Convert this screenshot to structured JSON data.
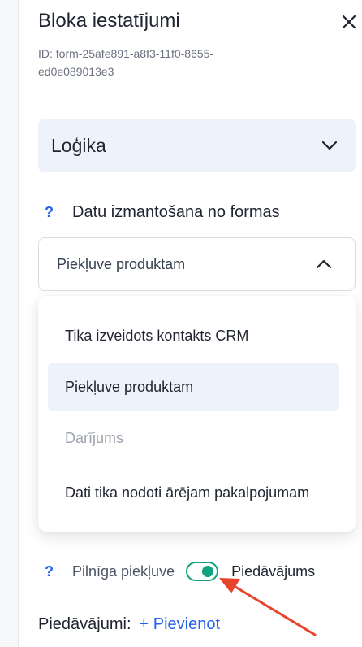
{
  "panel": {
    "title": "Bloka iestatījumi",
    "id_text": "ID: form-25afe891-a8f3-11f0-8655-ed0e089013e3"
  },
  "logic_section": {
    "label": "Loģika"
  },
  "data_usage": {
    "help": "?",
    "label": "Datu izmantošana no formas"
  },
  "select": {
    "value": "Piekļuve produktam",
    "options": [
      {
        "label": "Tika izveidots kontakts CRM",
        "state": "normal"
      },
      {
        "label": "Piekļuve produktam",
        "state": "selected"
      },
      {
        "label": "Darījums",
        "state": "disabled"
      },
      {
        "label": "Dati tika nodoti ārējam pakalpojumam",
        "state": "normal"
      }
    ]
  },
  "access_toggle": {
    "help": "?",
    "left_label": "Pilnīga piekļuve",
    "right_label": "Piedāvājums",
    "on": true
  },
  "offers": {
    "label": "Piedāvājumi:",
    "add_label": "+ Pievienot"
  },
  "colors": {
    "accent": "#2563eb",
    "toggle": "#10a37f",
    "annotation_arrow": "#e8432c",
    "highlight": "#eef2fb"
  }
}
